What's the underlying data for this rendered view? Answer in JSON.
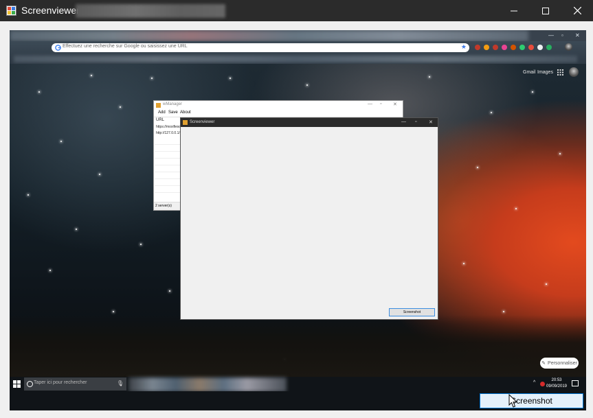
{
  "window": {
    "title": "Screenviewer -",
    "controls": [
      "minimize",
      "maximize",
      "close"
    ]
  },
  "screenshot": {
    "browser": {
      "omnibox_placeholder": "Effectuez une recherche sur Google ou saisissez une URL",
      "header_links": [
        "Gmail",
        "Images"
      ]
    },
    "wm_window": {
      "title": "wManager",
      "menu": [
        "Add",
        "Save",
        "About"
      ],
      "list_header": "URL",
      "rows": [
        "https://moxifieso",
        "http://127.0.0.1/"
      ],
      "status": "2 server(s)"
    },
    "inner_screenviewer": {
      "title": "Screenviewer",
      "button": "Screenshot"
    },
    "personalize_label": "Personnaliser",
    "taskbar": {
      "search_placeholder": "Taper ici pour rechercher",
      "time": "20:53",
      "date": "09/09/2019"
    }
  },
  "screenshot_button": "Screenshot"
}
